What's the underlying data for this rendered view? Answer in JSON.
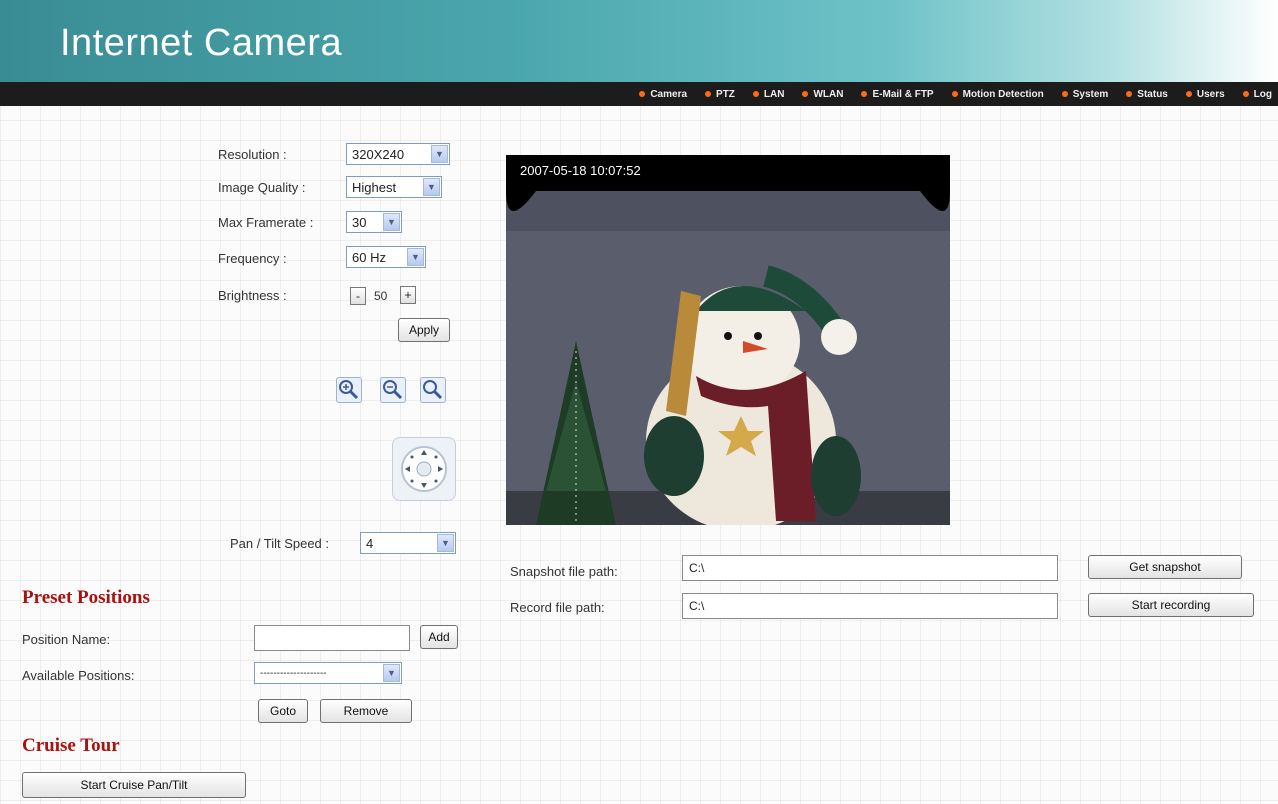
{
  "header": {
    "title": "Internet Camera"
  },
  "nav": [
    "Camera",
    "PTZ",
    "LAN",
    "WLAN",
    "E-Mail & FTP",
    "Motion Detection",
    "System",
    "Status",
    "Users",
    "Log"
  ],
  "settings": {
    "resolution_label": "Resolution :",
    "resolution_value": "320X240",
    "quality_label": "Image Quality :",
    "quality_value": "Highest",
    "framerate_label": "Max Framerate :",
    "framerate_value": "30",
    "frequency_label": "Frequency :",
    "frequency_value": "60 Hz",
    "brightness_label": "Brightness :",
    "brightness_minus": "-",
    "brightness_value": "50",
    "brightness_plus": "+",
    "apply_label": "Apply"
  },
  "ptz": {
    "speed_label": "Pan / Tilt Speed :",
    "speed_value": "4"
  },
  "video": {
    "timestamp": "2007-05-18 10:07:52"
  },
  "snapshot": {
    "label": "Snapshot file path:",
    "value": "C:\\",
    "button": "Get snapshot"
  },
  "record": {
    "label": "Record file path:",
    "value": "C:\\",
    "button": "Start recording"
  },
  "preset": {
    "title": "Preset Positions",
    "name_label": "Position Name:",
    "name_value": "",
    "add_label": "Add",
    "available_label": "Available Positions:",
    "available_value": "--------------------",
    "goto_label": "Goto",
    "remove_label": "Remove"
  },
  "cruise": {
    "title": "Cruise Tour",
    "start_label": "Start Cruise Pan/Tilt"
  },
  "colors": {
    "accent_red": "#aa1111",
    "nav_dot": "#ff6a1a",
    "banner_teal": "#4aa6ad"
  }
}
